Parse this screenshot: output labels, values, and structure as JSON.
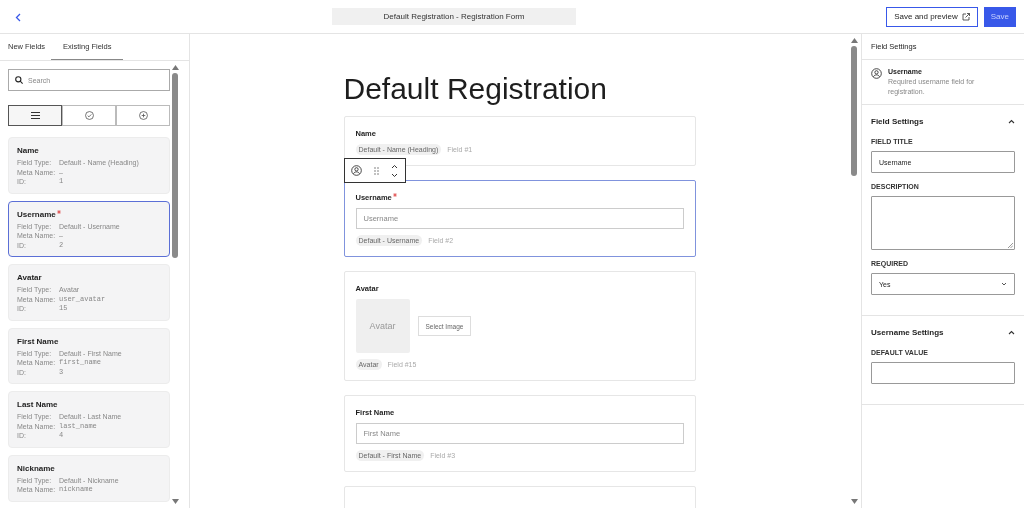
{
  "header": {
    "title": "Default Registration - Registration Form",
    "buttons": [
      {
        "label": "Save and preview",
        "kind": "outline"
      },
      {
        "label": "Save",
        "kind": "primary"
      }
    ]
  },
  "sidebar": {
    "tabs": [
      {
        "label": "New Fields",
        "selected": false
      },
      {
        "label": "Existing Fields",
        "selected": true
      }
    ],
    "search": {
      "placeholder": "Search"
    },
    "view_toggle": [
      {
        "kind": "list",
        "selected": true
      },
      {
        "kind": "check",
        "selected": false
      },
      {
        "kind": "plus",
        "selected": false
      }
    ],
    "fields": [
      {
        "name": "Name",
        "required": false,
        "selected": false,
        "type_label": "Field Type:",
        "type": "Default - Name (Heading)",
        "meta_label": "Meta Name:",
        "meta": "–",
        "id_label": "ID:",
        "id": "1"
      },
      {
        "name": "Username",
        "required": true,
        "selected": true,
        "type_label": "Field Type:",
        "type": "Default - Username",
        "meta_label": "Meta Name:",
        "meta": "–",
        "id_label": "ID:",
        "id": "2"
      },
      {
        "name": "Avatar",
        "required": false,
        "selected": false,
        "type_label": "Field Type:",
        "type": "Avatar",
        "meta_label": "Meta Name:",
        "meta": "user_avatar",
        "id_label": "ID:",
        "id": "15"
      },
      {
        "name": "First Name",
        "required": false,
        "selected": false,
        "type_label": "Field Type:",
        "type": "Default - First Name",
        "meta_label": "Meta Name:",
        "meta": "first_name",
        "id_label": "ID:",
        "id": "3"
      },
      {
        "name": "Last Name",
        "required": false,
        "selected": false,
        "type_label": "Field Type:",
        "type": "Default - Last Name",
        "meta_label": "Meta Name:",
        "meta": "last_name",
        "id_label": "ID:",
        "id": "4"
      },
      {
        "name": "Nickname",
        "required": false,
        "selected": false,
        "type_label": "Field Type:",
        "type": "Default - Nickname",
        "meta_label": "Meta Name:",
        "meta": "nickname"
      }
    ]
  },
  "form": {
    "title": "Default Registration",
    "fields": [
      {
        "kind": "heading",
        "label": "Name",
        "required": false,
        "selected": false,
        "tag": "Default - Name (Heading)",
        "number": "Field #1"
      },
      {
        "kind": "input",
        "label": "Username",
        "required": true,
        "selected": true,
        "placeholder": "Username",
        "tag": "Default - Username",
        "number": "Field #2"
      },
      {
        "kind": "avatar",
        "label": "Avatar",
        "required": false,
        "selected": false,
        "image_text": "Avatar",
        "button": "Select Image",
        "tag": "Avatar",
        "number": "Field #15"
      },
      {
        "kind": "input",
        "label": "First Name",
        "required": false,
        "selected": false,
        "placeholder": "First Name",
        "tag": "Default - First Name",
        "number": "Field #3"
      },
      {
        "kind": "cut",
        "selected": false
      }
    ]
  },
  "settings": {
    "title": "Field Settings",
    "field": {
      "name": "Username",
      "description": "Required username field for registration."
    },
    "sections": [
      {
        "title": "Field Settings",
        "expanded": true,
        "controls": [
          {
            "kind": "text",
            "label": "FIELD TITLE",
            "value": "Username"
          },
          {
            "kind": "textarea",
            "label": "DESCRIPTION"
          },
          {
            "kind": "select",
            "label": "REQUIRED",
            "value": "Yes"
          }
        ]
      },
      {
        "title": "Username Settings",
        "expanded": true,
        "controls": [
          {
            "kind": "text",
            "label": "DEFAULT VALUE"
          }
        ]
      }
    ]
  }
}
